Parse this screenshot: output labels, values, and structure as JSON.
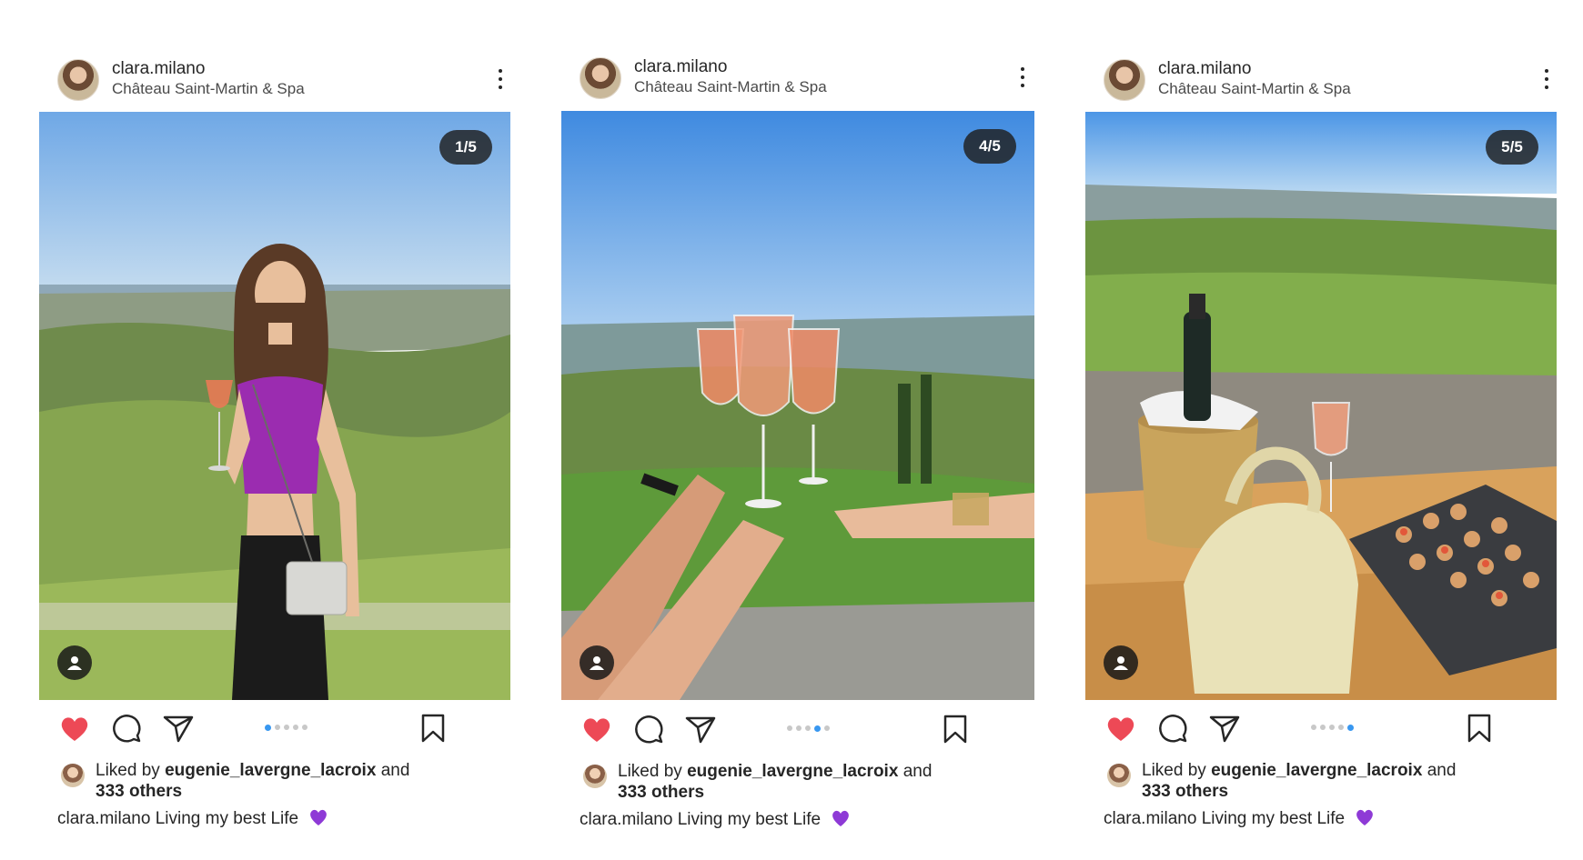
{
  "posts": [
    {
      "username": "clara.milano",
      "location": "Château Saint-Martin & Spa",
      "counter": "1/5",
      "active_dot": 0,
      "liked_prefix": "Liked by",
      "liked_user": "eugenie_lavergne_lacroix",
      "liked_and": "and",
      "liked_others": "333 others",
      "caption_user": "clara.milano",
      "caption_text": "Living my best Life"
    },
    {
      "username": "clara.milano",
      "location": "Château Saint-Martin & Spa",
      "counter": "4/5",
      "active_dot": 3,
      "liked_prefix": "Liked by",
      "liked_user": "eugenie_lavergne_lacroix",
      "liked_and": "and",
      "liked_others": "333 others",
      "caption_user": "clara.milano",
      "caption_text": "Living my best Life"
    },
    {
      "username": "clara.milano",
      "location": "Château Saint-Martin & Spa",
      "counter": "5/5",
      "active_dot": 4,
      "liked_prefix": "Liked by",
      "liked_user": "eugenie_lavergne_lacroix",
      "liked_and": "and",
      "liked_others": "333 others",
      "caption_user": "clara.milano",
      "caption_text": "Living my best Life"
    }
  ],
  "icons": {
    "like": "heart-icon-filled",
    "comment": "comment-icon",
    "share": "send-icon",
    "save": "bookmark-icon",
    "more": "more-vertical-icon",
    "tag": "user-tag-icon",
    "emoji": "purple-heart-emoji"
  },
  "colors": {
    "like_red": "#ed4956",
    "dot_active": "#3897f0",
    "dot_inactive": "#c8c8c8",
    "emoji_purple": "#8e3ad6"
  }
}
